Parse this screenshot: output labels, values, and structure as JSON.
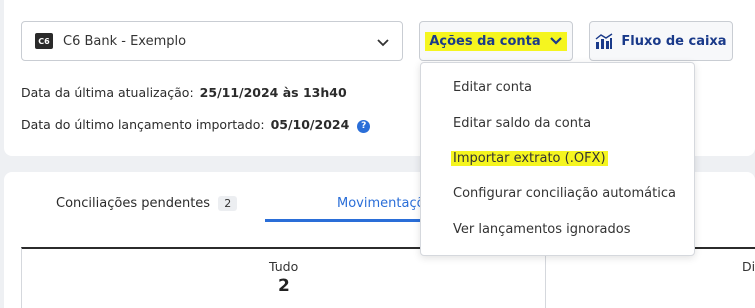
{
  "account_select": {
    "logo_text": "C6",
    "account_name": "C6 Bank - Exemplo"
  },
  "actions_button": {
    "label": "Ações da conta"
  },
  "cashflow_button": {
    "label": "Fluxo de caixa"
  },
  "info": {
    "last_update_label": "Data da última atualização:",
    "last_update_value": "25/11/2024 às 13h40",
    "last_import_label": "Data do último lançamento importado:",
    "last_import_value": "05/10/2024",
    "help_icon_glyph": "?"
  },
  "tabs": {
    "pending_label": "Conciliações pendentes",
    "pending_count": "2",
    "movements_label": "Movimentaçõ"
  },
  "summary": {
    "all_label": "Tudo",
    "all_value": "2",
    "second_label": "Di"
  },
  "dropdown_menu": {
    "items": [
      "Editar conta",
      "Editar saldo da conta",
      "Importar extrato (.OFX)",
      "Configurar conciliação automática",
      "Ver lançamentos ignorados"
    ]
  },
  "colors": {
    "accent": "#2a6ed8",
    "button_text": "#1a3a8a",
    "highlight": "#f5f51f"
  }
}
